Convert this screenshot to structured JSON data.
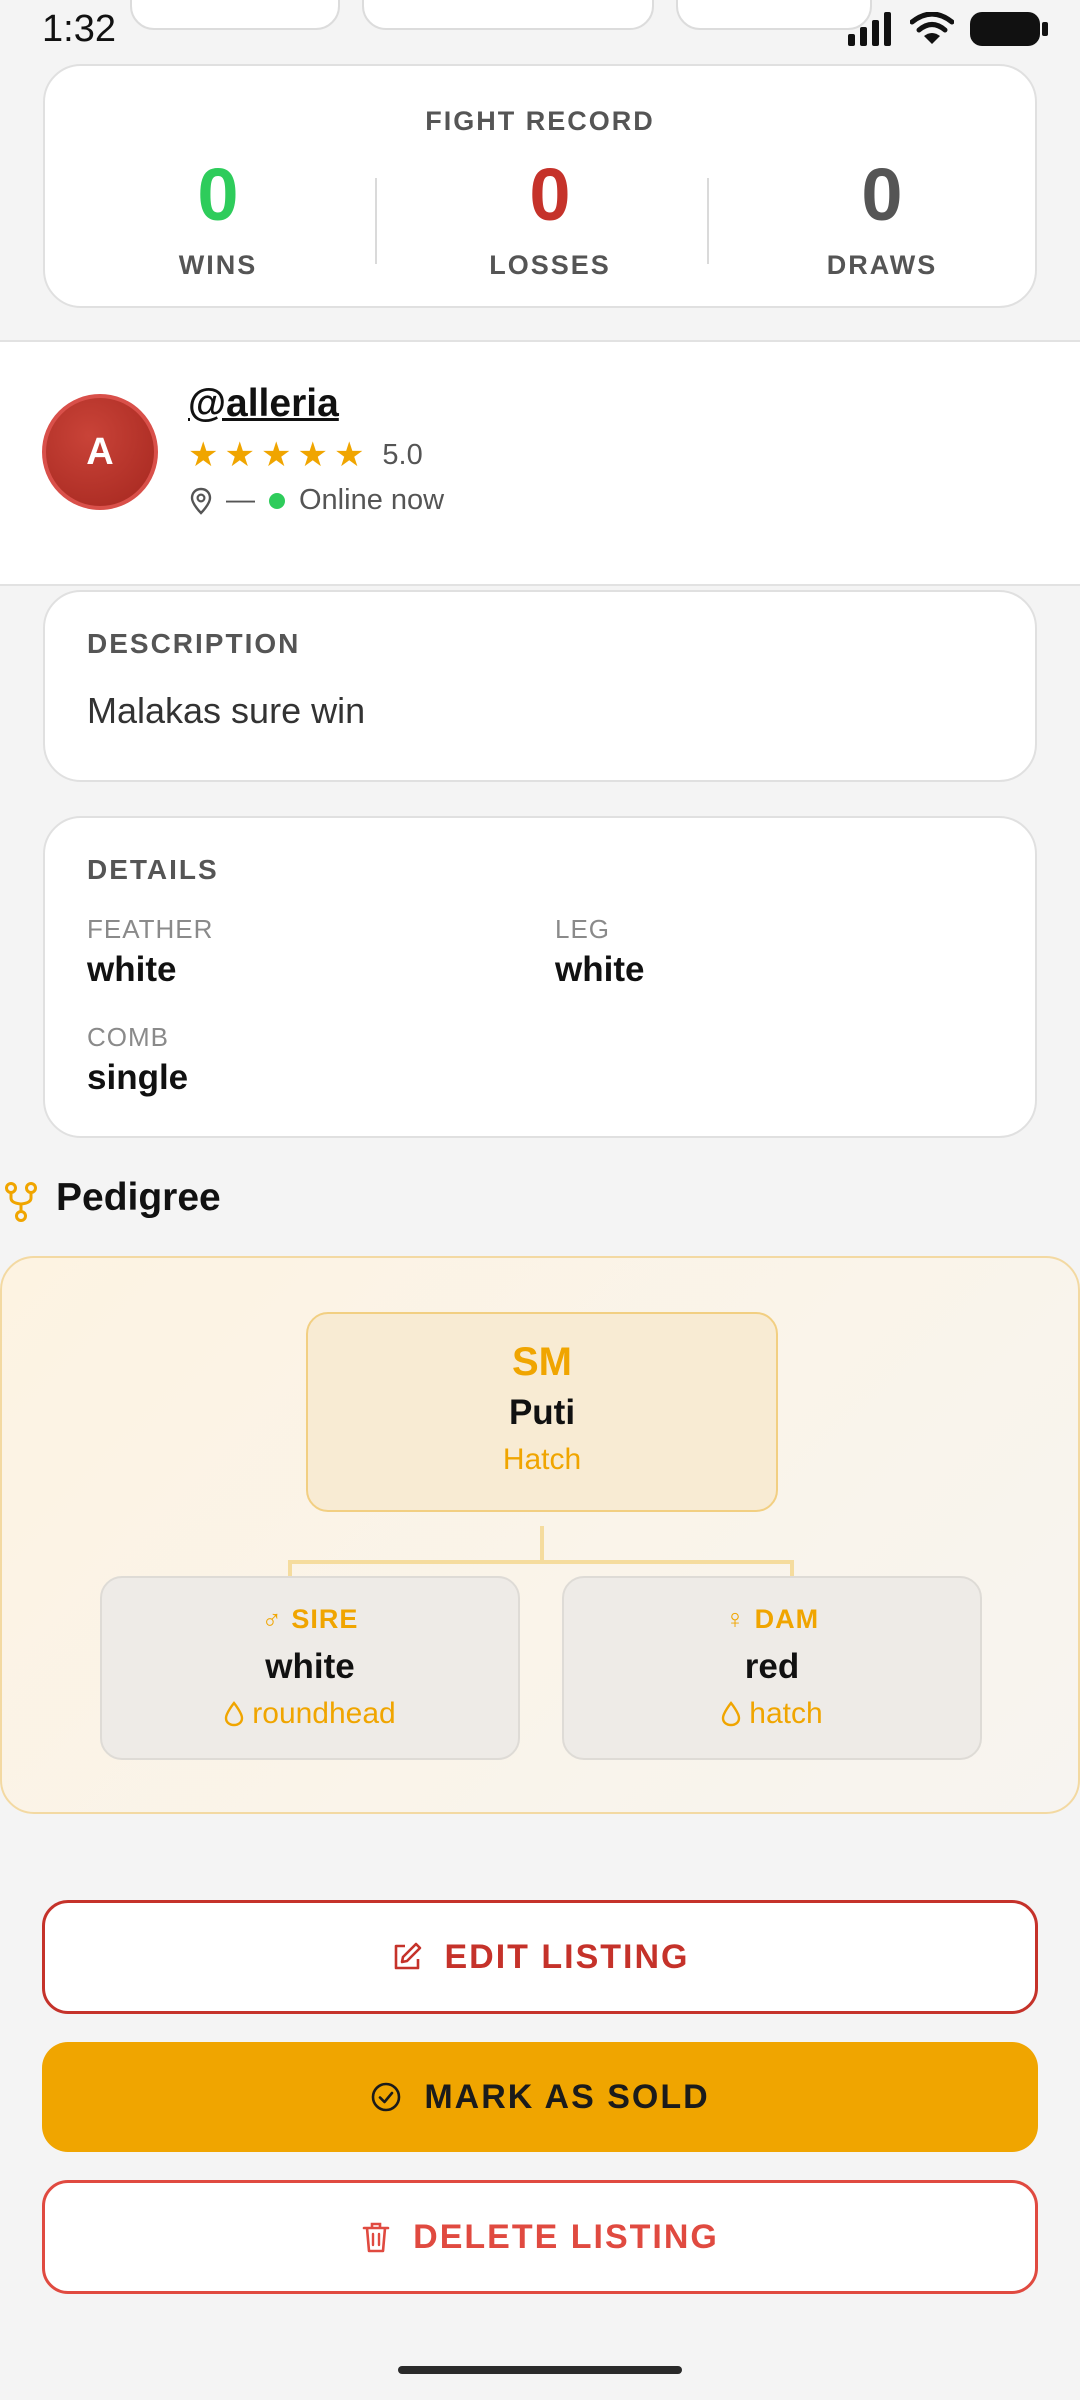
{
  "status_bar": {
    "time": "1:32"
  },
  "fight_record": {
    "title": "FIGHT RECORD",
    "stats": [
      {
        "value": "0",
        "label": "WINS",
        "color": "#2ecc5b"
      },
      {
        "value": "0",
        "label": "LOSSES",
        "color": "#c5322a"
      },
      {
        "value": "0",
        "label": "DRAWS",
        "color": "#555555"
      }
    ]
  },
  "seller": {
    "avatar_initial": "A",
    "username": "@alleria",
    "rating": "5.0",
    "stars": 5,
    "location": "—",
    "online_status": "Online now"
  },
  "description": {
    "label": "DESCRIPTION",
    "text": "Malakas sure win"
  },
  "details": {
    "label": "DETAILS",
    "feather_label": "FEATHER",
    "feather_value": "white",
    "leg_label": "LEG",
    "leg_value": "white",
    "comb_label": "COMB",
    "comb_value": "single"
  },
  "pedigree": {
    "title": "Pedigree",
    "root": {
      "code": "SM",
      "name": "Puti",
      "sub": "Hatch"
    },
    "sire": {
      "role": "SIRE",
      "symbol": "♂",
      "name": "white",
      "sub": "roundhead"
    },
    "dam": {
      "role": "DAM",
      "symbol": "♀",
      "name": "red",
      "sub": "hatch"
    }
  },
  "actions": {
    "edit_label": "EDIT LISTING",
    "sold_label": "MARK AS SOLD",
    "delete_label": "DELETE LISTING"
  },
  "colors": {
    "accent": "#f0a500",
    "danger": "#c5322a",
    "success": "#2ecc5b"
  },
  "icons": [
    "signal-icon",
    "wifi-icon",
    "battery-icon",
    "star-icon",
    "location-pin-icon",
    "pedigree-tree-icon",
    "drop-icon",
    "edit-icon",
    "check-circle-icon",
    "trash-icon"
  ]
}
